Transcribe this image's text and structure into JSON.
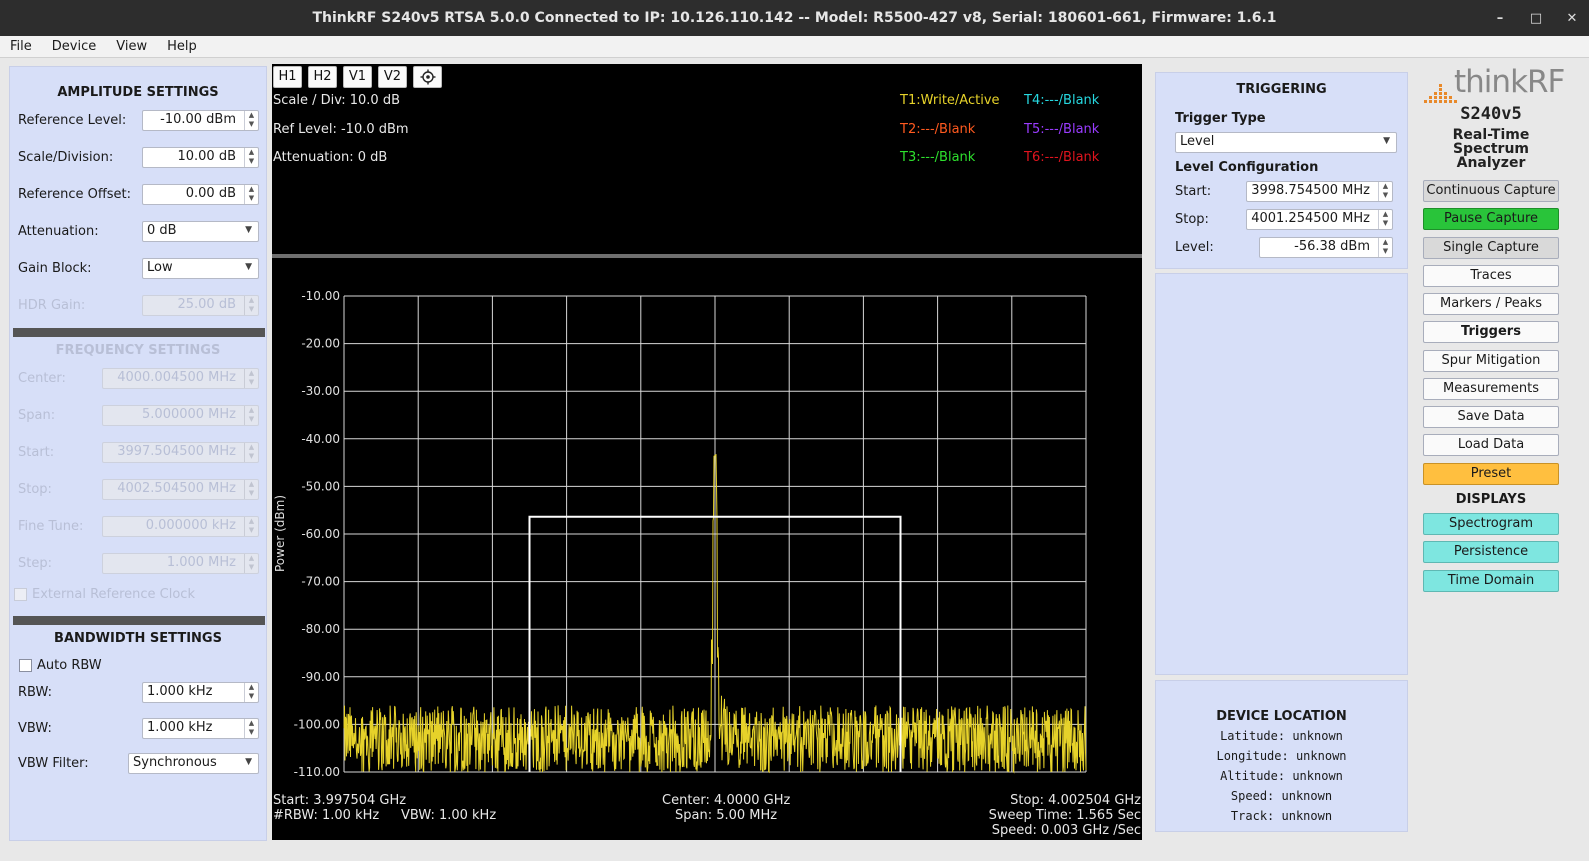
{
  "window": {
    "title": "ThinkRF S240v5 RTSA 5.0.0 Connected to IP: 10.126.110.142 -- Model: R5500-427 v8, Serial: 180601-661, Firmware: 1.6.1",
    "minimize": "–",
    "maximize": "□",
    "close": "✕"
  },
  "menu": [
    "File",
    "Device",
    "View",
    "Help"
  ],
  "amplitude": {
    "title": "AMPLITUDE SETTINGS",
    "ref_level_label": "Reference Level:",
    "ref_level": "-10.00 dBm",
    "scale_label": "Scale/Division:",
    "scale": "10.00 dB",
    "offset_label": "Reference Offset:",
    "offset": "0.00 dB",
    "atten_label": "Attenuation:",
    "atten": "0 dB",
    "gain_label": "Gain Block:",
    "gain": "Low",
    "hdr_label": "HDR Gain:",
    "hdr": "25.00 dB"
  },
  "frequency": {
    "title": "FREQUENCY SETTINGS",
    "center_label": "Center:",
    "center": "4000.004500 MHz",
    "span_label": "Span:",
    "span": "5.000000 MHz",
    "start_label": "Start:",
    "start": "3997.504500 MHz",
    "stop_label": "Stop:",
    "stop": "4002.504500 MHz",
    "fine_label": "Fine Tune:",
    "fine": "0.000000 kHz",
    "step_label": "Step:",
    "step": "1.000 MHz",
    "ext_ref": "External Reference Clock"
  },
  "bandwidth": {
    "title": "BANDWIDTH SETTINGS",
    "auto_rbw": "Auto RBW",
    "rbw_label": "RBW:",
    "rbw": "1.000 kHz",
    "vbw_label": "VBW:",
    "vbw": "1.000 kHz",
    "vbw_filter_label": "VBW Filter:",
    "vbw_filter": "Synchronous"
  },
  "toolbar": [
    "H1",
    "H2",
    "V1",
    "V2"
  ],
  "plot_info": {
    "scale": "Scale / Div: 10.0 dB",
    "ref": "Ref Level: -10.0 dBm",
    "atten": "Attenuation: 0 dB"
  },
  "traces": [
    {
      "label": "T1:Write/Active",
      "color": "#e6d22a"
    },
    {
      "label": "T2:---/Blank",
      "color": "#ff5a1f"
    },
    {
      "label": "T3:---/Blank",
      "color": "#2ee02e"
    },
    {
      "label": "T4:---/Blank",
      "color": "#26d8e0"
    },
    {
      "label": "T5:---/Blank",
      "color": "#9a3cff"
    },
    {
      "label": "T6:---/Blank",
      "color": "#e0141e"
    }
  ],
  "chart_data": {
    "type": "line",
    "ylabel": "Power (dBm)",
    "ylim": [
      -110,
      -10
    ],
    "yticks": [
      "-10.00",
      "-20.00",
      "-30.00",
      "-40.00",
      "-50.00",
      "-60.00",
      "-70.00",
      "-80.00",
      "-90.00",
      "-100.00",
      "-110.00"
    ],
    "xlim": [
      3997.5045,
      4002.5045
    ],
    "x_unit": "MHz",
    "grid": true,
    "peak": {
      "x": 4000.0045,
      "y": -43
    },
    "noise_floor": -100,
    "trigger_box": {
      "x_start": 3998.7545,
      "x_stop": 4001.2545,
      "level": -56.38
    },
    "series": [
      {
        "color": "#e6d22a"
      }
    ]
  },
  "plot_footer": {
    "start": "Start: 3.997504 GHz",
    "rbw": "#RBW: 1.00 kHz",
    "vbw": "VBW: 1.00 kHz",
    "center": "Center: 4.0000 GHz",
    "span": "Span: 5.00 MHz",
    "stop": "Stop: 4.002504 GHz",
    "sweep": "Sweep Time: 1.565 Sec",
    "speed": "Speed: 0.003 GHz /Sec"
  },
  "triggering": {
    "title": "TRIGGERING",
    "type_label": "Trigger Type",
    "type": "Level",
    "level_config": "Level Configuration",
    "start_label": "Start:",
    "start": "3998.754500 MHz",
    "stop_label": "Stop:",
    "stop": "4001.254500 MHz",
    "level_label": "Level:",
    "level": "-56.38 dBm"
  },
  "device_location": {
    "title": "DEVICE LOCATION",
    "latitude": "Latitude: unknown",
    "longitude": "Longitude: unknown",
    "altitude": "Altitude: unknown",
    "speed": "Speed: unknown",
    "track": "Track: unknown"
  },
  "logo": {
    "brand": "thinkRF",
    "model": "S240v5",
    "sub1": "Real-Time",
    "sub2": "Spectrum Analyzer",
    "accent": "#e8892a"
  },
  "controls": {
    "continuous": "Continuous Capture",
    "pause": "Pause Capture",
    "single": "Single Capture",
    "traces": "Traces",
    "markers": "Markers / Peaks",
    "triggers": "Triggers",
    "spur": "Spur Mitigation",
    "measurements": "Measurements",
    "save": "Save Data",
    "load": "Load Data",
    "preset": "Preset",
    "displays_title": "DISPLAYS",
    "spectrogram": "Spectrogram",
    "persistence": "Persistence",
    "time_domain": "Time Domain"
  }
}
